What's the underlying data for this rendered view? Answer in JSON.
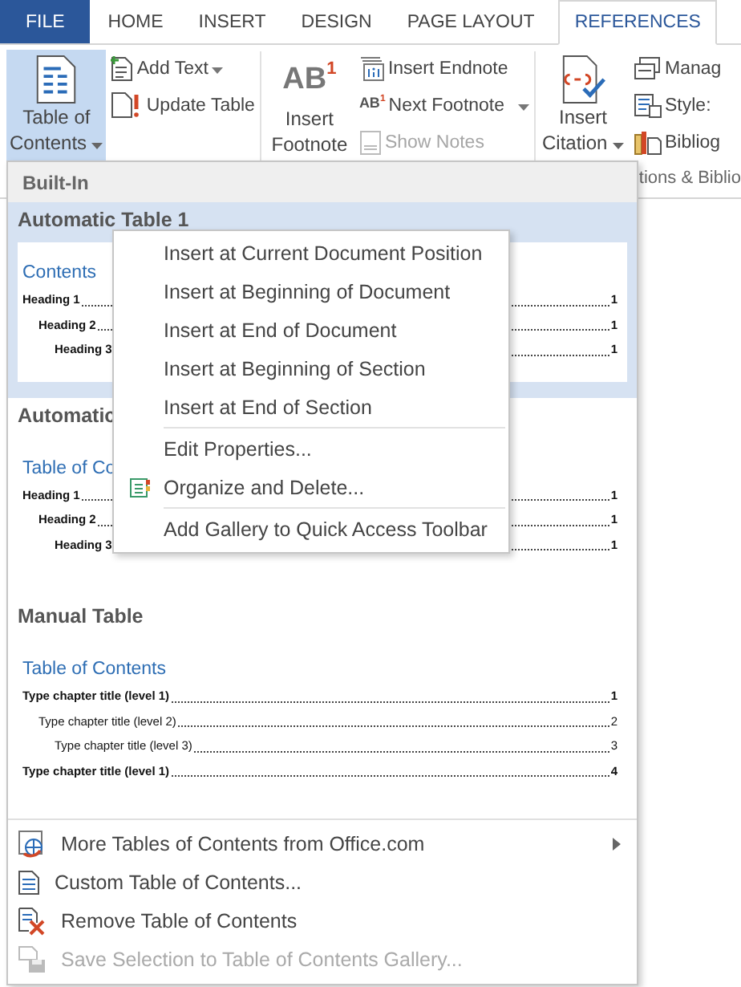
{
  "tabs": [
    {
      "label": "FILE",
      "kind": "file",
      "selected": false
    },
    {
      "label": "HOME",
      "kind": "tab",
      "selected": false
    },
    {
      "label": "INSERT",
      "kind": "tab",
      "selected": false
    },
    {
      "label": "DESIGN",
      "kind": "tab",
      "selected": false
    },
    {
      "label": "PAGE LAYOUT",
      "kind": "tab",
      "selected": false
    },
    {
      "label": "REFERENCES",
      "kind": "tab",
      "selected": true
    }
  ],
  "ribbon_groups": [
    {
      "large_button": {
        "label_lines": [
          "Table of",
          "Contents"
        ],
        "dropdown": true,
        "pressed": true
      },
      "small_buttons": [
        {
          "label": "Add Text",
          "dropdown": true,
          "disabled": false
        },
        {
          "label": "Update Table",
          "dropdown": false,
          "disabled": false
        }
      ]
    },
    {
      "large_button": {
        "label_lines": [
          "Insert",
          "Footnote"
        ],
        "icon_text": "AB",
        "icon_sup": "1",
        "dropdown": false,
        "pressed": false
      },
      "small_buttons": [
        {
          "label": "Insert Endnote",
          "dropdown": false,
          "disabled": false
        },
        {
          "label": "Next Footnote",
          "icon_text": "AB",
          "icon_sup": "1",
          "dropdown": true,
          "disabled": false
        },
        {
          "label": "Show Notes",
          "dropdown": false,
          "disabled": true
        }
      ]
    },
    {
      "large_button": {
        "label_lines": [
          "Insert",
          "Citation"
        ],
        "dropdown": true,
        "pressed": false
      },
      "small_buttons": [
        {
          "label": "Manag",
          "dropdown": false,
          "disabled": false
        },
        {
          "label": "Style:",
          "dropdown": false,
          "disabled": false
        },
        {
          "label": "Bibliog",
          "dropdown": false,
          "disabled": false
        }
      ],
      "label": "tions & Biblio"
    }
  ],
  "gallery": {
    "header": "Built-In",
    "items": [
      {
        "title": "Automatic Table 1",
        "highlighted": true,
        "preview": {
          "heading": "Contents",
          "entries": [
            {
              "text": "Heading 1",
              "page": "1",
              "bold": true,
              "children": [
                {
                  "text": "Heading 2",
                  "page": "1",
                  "bold": true,
                  "children": [
                    {
                      "text": "Heading 3",
                      "page": "1",
                      "bold": true
                    }
                  ]
                }
              ]
            }
          ]
        }
      },
      {
        "title": "Automatic",
        "highlighted": false,
        "preview": {
          "heading": "Table of Co",
          "entries": [
            {
              "text": "Heading 1",
              "page": "1",
              "bold": true,
              "children": [
                {
                  "text": "Heading 2",
                  "page": "1",
                  "bold": true,
                  "children": [
                    {
                      "text": "Heading 3",
                      "page": "1",
                      "bold": true
                    }
                  ]
                }
              ]
            }
          ]
        }
      },
      {
        "title": "Manual Table",
        "highlighted": false,
        "preview": {
          "heading": "Table of Contents",
          "entries": [
            {
              "text": "Type chapter title (level 1)",
              "page": "1",
              "bold": true,
              "children": [
                {
                  "text": "Type chapter title (level 2)",
                  "page": "2",
                  "bold": false,
                  "children": [
                    {
                      "text": "Type chapter title (level 3)",
                      "page": "3",
                      "bold": false
                    }
                  ]
                }
              ]
            },
            {
              "text": "Type chapter title (level 1)",
              "page": "4",
              "bold": true
            }
          ]
        }
      }
    ],
    "footer_items": [
      {
        "label": "More Tables of Contents from Office.com",
        "submenu": true,
        "disabled": false
      },
      {
        "label": "Custom Table of Contents...",
        "submenu": false,
        "disabled": false
      },
      {
        "label": "Remove Table of Contents",
        "submenu": false,
        "disabled": false
      },
      {
        "label": "Save Selection to Table of Contents Gallery...",
        "submenu": false,
        "disabled": true
      }
    ]
  },
  "context_menu": [
    {
      "label": "Insert at Current Document Position",
      "separator_before": false,
      "has_icon": false
    },
    {
      "label": "Insert at Beginning of Document",
      "separator_before": false,
      "has_icon": false
    },
    {
      "label": "Insert at End of Document",
      "separator_before": false,
      "has_icon": false
    },
    {
      "label": "Insert at Beginning of Section",
      "separator_before": false,
      "has_icon": false
    },
    {
      "label": "Insert at End of Section",
      "separator_before": false,
      "has_icon": false
    },
    {
      "label": "Edit Properties...",
      "separator_before": true,
      "has_icon": false
    },
    {
      "label": "Organize and Delete...",
      "separator_before": false,
      "has_icon": true
    },
    {
      "label": "Add Gallery to Quick Access Toolbar",
      "separator_before": true,
      "has_icon": false
    }
  ]
}
